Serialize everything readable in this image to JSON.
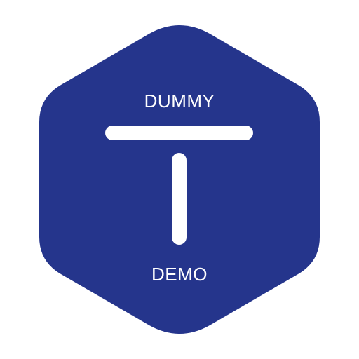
{
  "logo": {
    "top_text": "DUMMY",
    "bottom_text": "DEMO",
    "letter_glyph": "T",
    "colors": {
      "badge": "#25358C",
      "foreground": "#FFFFFF",
      "background": "#FFFFFF"
    }
  }
}
